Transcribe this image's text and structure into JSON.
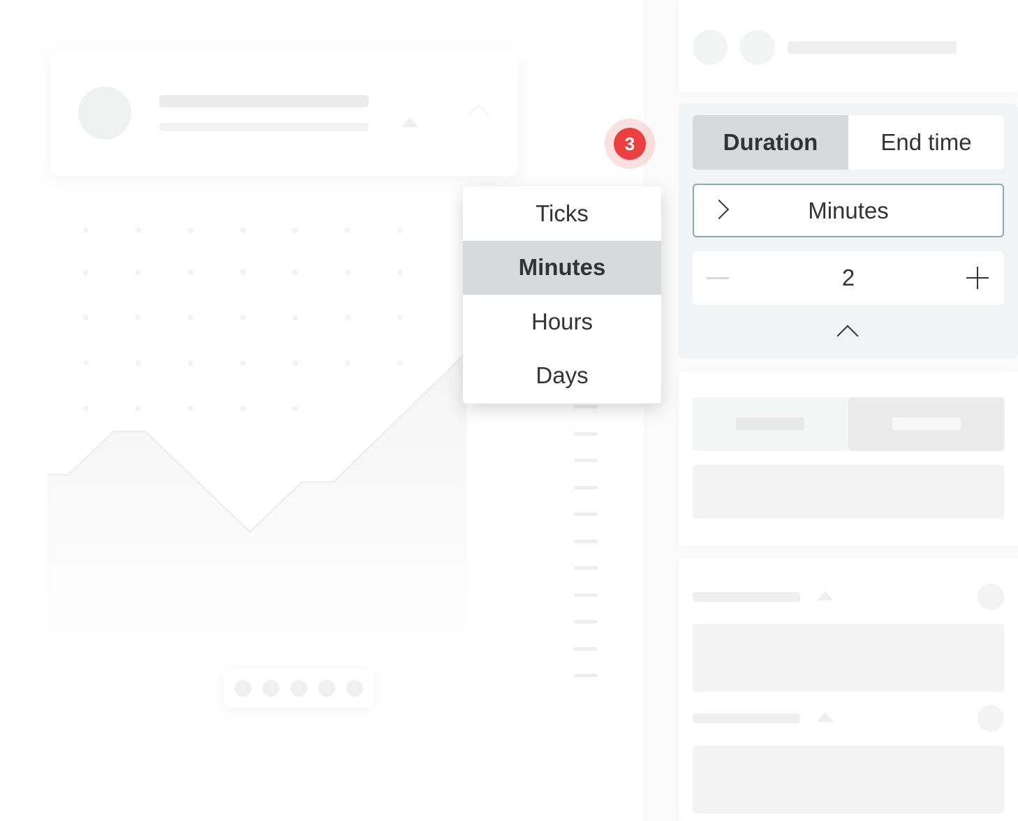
{
  "trade_panel": {
    "tabs": [
      {
        "label": "Duration",
        "active": true
      },
      {
        "label": "End time",
        "active": false
      }
    ],
    "unit_selected": "Minutes",
    "duration_value": "2"
  },
  "dropdown": {
    "options": [
      {
        "label": "Ticks",
        "selected": false
      },
      {
        "label": "Minutes",
        "selected": true
      },
      {
        "label": "Hours",
        "selected": false
      },
      {
        "label": "Days",
        "selected": false
      }
    ]
  },
  "step_badge": "3",
  "colors": {
    "accent_border": "#85acb0",
    "selected_bg": "#d6dadb",
    "badge_red": "#ec3f3f",
    "panel_bg": "#f2f3f4"
  },
  "icons": [
    "chevron-right-icon",
    "minus-icon",
    "plus-icon",
    "chevron-up-icon"
  ]
}
